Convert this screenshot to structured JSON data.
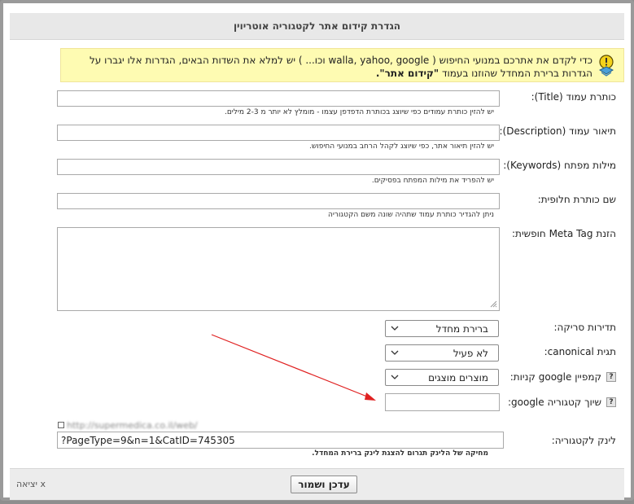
{
  "dialog": {
    "title": "הגדרת קידום אתר לקטגוריה אוטריוין"
  },
  "notice": {
    "text_part1": "כדי לקדם את אתרכם במנועי החיפוש ( walla, yahoo, google וכו... ) יש למלא את השדות הבאים, הגדרות אלו יגברו על הגדרות ברירת המחדל שהוזנו בעמוד ",
    "text_link": "\"קידום אתר\".",
    "icon": "lightbulb-warning-icon"
  },
  "form": {
    "title_label": "כותרת עמוד (Title):",
    "title_value": "",
    "title_hint": "יש להזין כותרת עמודים כפי שיוצג בכותרת הדפדפן עצמו - מומלץ לא יותר מ 2-3 מילים.",
    "description_label": "תיאור עמוד (Description):",
    "description_value": "",
    "description_hint": "יש להזין תיאור אתר, כפי שיוצג לקהל הרחב במנועי החיפוש.",
    "keywords_label": "מילות מפתח (Keywords):",
    "keywords_value": "",
    "keywords_hint": "יש להפריד את מילות המפתח בפסיקים.",
    "alt_title_label": "שם כותרת חלופית:",
    "alt_title_value": "",
    "alt_title_hint": "ניתן להגדיר כותרת עמוד שתהיה שונה משם הקטגוריה",
    "metatag_label": "הזנת Meta Tag חופשית:",
    "metatag_value": "",
    "crawl_label": "תדירות סריקה:",
    "crawl_value": "ברירת מחדל",
    "canonical_label": "תגית canonical:",
    "canonical_value": "לא פעיל",
    "campaign_label": "קמפיין google קניות:",
    "campaign_value": "מוצרים מוצגים",
    "google_cat_label": "שיוך קטגוריה google:",
    "google_cat_value": "",
    "link_label": "לינק לקטגוריה:",
    "link_url_preview": "http://supermedica.co.il/web/",
    "link_value": "?PageType=9&n=1&CatID=745305",
    "link_hint": "מחיקה של הלינק תגרום להצגת לינק ברירת המחדל."
  },
  "footer": {
    "save_label": "עדכן ושמור",
    "exit_label": "x יציאה"
  },
  "colors": {
    "notice_bg": "#fefbb2",
    "arrow": "#e02020",
    "titlebar_bg": "#e8e8e8"
  }
}
